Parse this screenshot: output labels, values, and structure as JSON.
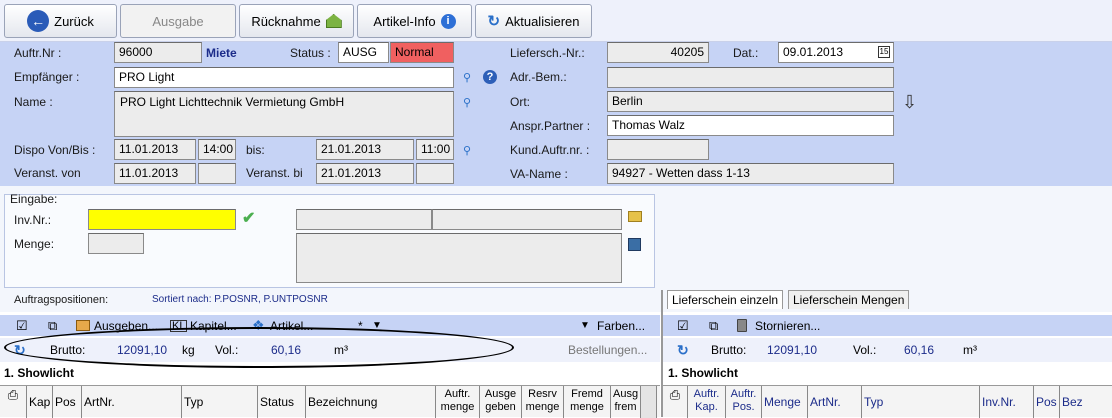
{
  "toolbar": {
    "back": "Zurück",
    "ausgabe": "Ausgabe",
    "ruecknahme": "Rücknahme",
    "artikel_info": "Artikel-Info",
    "aktualisieren": "Aktualisieren"
  },
  "header": {
    "auftr_nr_label": "Auftr.Nr :",
    "auftr_nr": "96000",
    "miete": "Miete",
    "status_label": "Status :",
    "status": "AUSG",
    "status_flag": "Normal",
    "empfaenger_label": "Empfänger :",
    "empfaenger": "PRO Light",
    "name_label": "Name :",
    "name": "PRO Light Lichttechnik Vermietung GmbH",
    "dispo_label": "Dispo Von/Bis :",
    "dispo_von_date": "11.01.2013",
    "dispo_von_time": "14:00",
    "bis_label": "bis:",
    "dispo_bis_date": "21.01.2013",
    "dispo_bis_time": "11:00",
    "veranst_von_label": "Veranst. von",
    "veranst_von": "11.01.2013",
    "veranst_bi_label": "Veranst. bi",
    "veranst_bi": "21.01.2013",
    "liefersch_label": "Liefersch.-Nr.:",
    "liefersch": "40205",
    "dat_label": "Dat.:",
    "dat": "09.01.2013",
    "cal": "15",
    "adr_bem_label": "Adr.-Bem.:",
    "adr_bem": "",
    "ort_label": "Ort:",
    "ort": "Berlin",
    "anspr_label": "Anspr.Partner :",
    "anspr": "Thomas Walz",
    "kund_label": "Kund.Auftr.nr. :",
    "kund": "",
    "va_label": "VA-Name :",
    "va": "94927 - Wetten dass 1-13"
  },
  "eingabe": {
    "title": "Eingabe:",
    "inv_label": "Inv.Nr.:",
    "inv_value": "",
    "menge_label": "Menge:",
    "menge_value": ""
  },
  "auftragspositionen": {
    "label": "Auftragspositionen:",
    "sorted": "Sortiert nach: P.POSNR, P.UNTPOSNR"
  },
  "left_toolbar": {
    "ausgeben": "Ausgeben...",
    "kapitel": "Kapitel...",
    "artikel": "Artikel...",
    "star": "*",
    "farben": "Farben..."
  },
  "left_sum": {
    "brutto_label": "Brutto:",
    "brutto": "12091,10",
    "unit_kg": "kg",
    "vol_label": "Vol.:",
    "vol": "60,16",
    "unit_m3": "m³",
    "bestellungen": "Bestellungen..."
  },
  "left_section": "1. Showlicht",
  "left_columns": [
    "Kap",
    "Pos",
    "ArtNr.",
    "Typ",
    "Status",
    "Bezeichnung",
    "Auftr. menge",
    "Ausge geben",
    "Resrv menge",
    "Fremd menge",
    "Ausg frem"
  ],
  "tabs": [
    "Lieferschein einzeln",
    "Lieferschein Mengen"
  ],
  "right_toolbar": {
    "stornieren": "Stornieren..."
  },
  "right_sum": {
    "brutto_label": "Brutto:",
    "brutto": "12091,10",
    "vol_label": "Vol.:",
    "vol": "60,16",
    "unit_m3": "m³"
  },
  "right_section": "1. Showlicht",
  "right_columns": [
    "Auftr. Kap.",
    "Auftr. Pos.",
    "Menge",
    "ArtNr.",
    "Typ",
    "Inv.Nr.",
    "Pos",
    "Bez"
  ],
  "colors": {
    "header_bg": "#c6d3f5",
    "status_flag": "#f06060",
    "inv_field": "#ffff00"
  }
}
